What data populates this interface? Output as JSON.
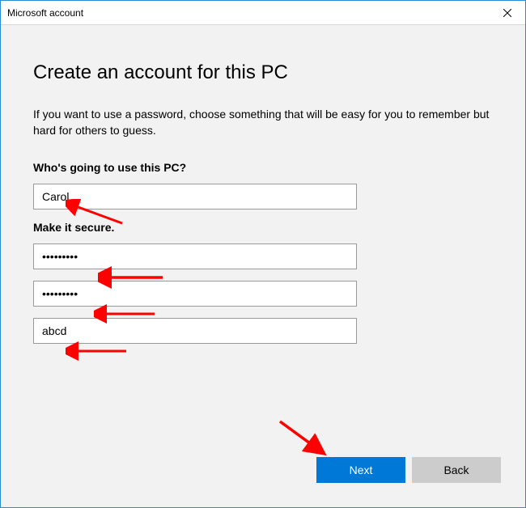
{
  "titlebar": {
    "text": "Microsoft account"
  },
  "heading": "Create an account for this PC",
  "description": "If you want to use a password, choose something that will be easy for you to remember but hard for others to guess.",
  "section_user": "Who's going to use this PC?",
  "section_secure": "Make it secure.",
  "fields": {
    "username": "Carol",
    "password": "•••••••••",
    "confirm": "•••••••••",
    "hint": "abcd"
  },
  "buttons": {
    "next": "Next",
    "back": "Back"
  }
}
